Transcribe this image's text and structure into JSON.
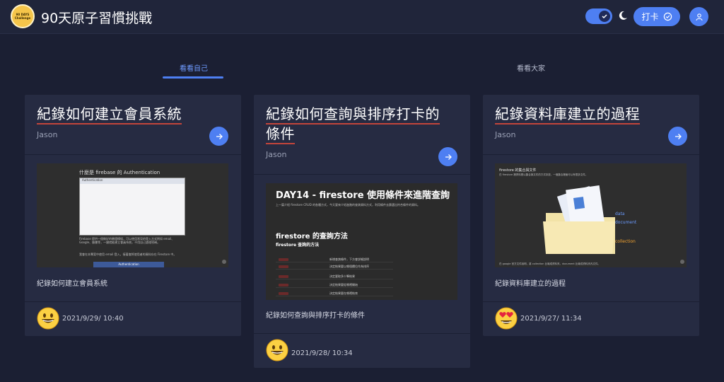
{
  "app": {
    "title": "90天原子習慣挑戰",
    "logo_text_line1": "90 DAYS",
    "logo_text_line2": "Challenge"
  },
  "header": {
    "checkin_label": "打卡",
    "dark_mode": true
  },
  "tabs": [
    {
      "label": "看看自己",
      "active": true
    },
    {
      "label": "看看大家",
      "active": false
    }
  ],
  "cards": [
    {
      "title_lines": [
        "紀錄如何建立會員系統"
      ],
      "author": "Jason",
      "description": "紀錄如何建立會員系統",
      "timestamp": "2021/9/29/ 10:40",
      "emoji": "grinning-face",
      "thumb": {
        "heading": "什麼是 firebase 的 Authentication",
        "window_title": "Authentication",
        "para": "Firebase 提供一個做好的驗證模組，可以使用常見的登入方式例如 email、Google、臉書等，一鍵就能建立會員系統，不用自己處理密碼。",
        "para2": "我會在本專案中使用 email 登入，接著會將使用者的資料存在 Firestore 中。",
        "bottom": "Authentication"
      }
    },
    {
      "title_lines": [
        "紀錄如何查詢與排序打卡的",
        "條件"
      ],
      "author": "Jason",
      "description": "紀錄如何查詢與排序打卡的條件",
      "timestamp": "2021/9/28/ 10:34",
      "emoji": "grinning-face",
      "thumb": {
        "heading": "DAY14 - firestore 使用條件來進階查詢",
        "para": "上一篇介紹 firestore CRUD 的各種方式，今天要來介紹進階的查詢資料方式，利用條件去篩選出符合條件的資料。",
        "h2": "firestore 的查詢方法",
        "h3": "firestore 查詢的方法",
        "rows": [
          "新增查詢條件，下方會詳細說明",
          "決定結果要以哪個欄位作為排序",
          "決定要取多少筆結果",
          "決定結果要從哪裡開始",
          "決定結果要在哪裡結束"
        ]
      }
    },
    {
      "title_lines": [
        "紀錄資料庫建立的過程"
      ],
      "author": "Jason",
      "description": "紀錄資料庫建立的過程",
      "timestamp": "2021/9/27/ 11:34",
      "emoji": "heart-eyes-face",
      "thumb": {
        "heading": "firestore 的集合與文件",
        "para": "在 firestore 裡資料是以集合與文件的方式存放，一個集合裡面可以有很多文件。",
        "labels": [
          "data",
          "document",
          "collection"
        ],
        "footer": "在 google 官方文件說明，將 collection 比喻成資料夾，document 比喻成資料夾內文件。"
      }
    }
  ]
}
